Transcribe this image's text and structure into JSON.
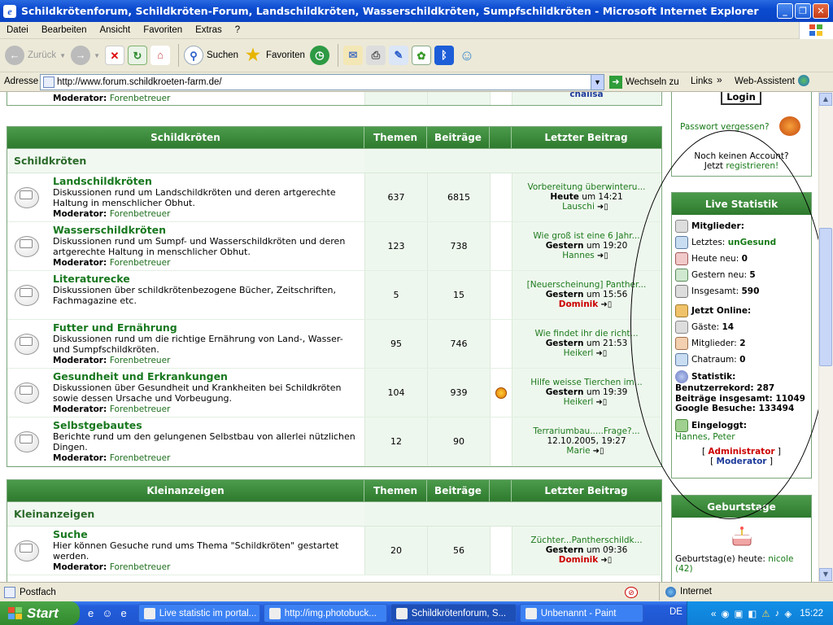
{
  "window": {
    "title": "Schildkrötenforum, Schildkröten-Forum, Landschildkröten, Wasserschildkröten, Sumpfschildkröten  - Microsoft Internet Explorer"
  },
  "menu": [
    "Datei",
    "Bearbeiten",
    "Ansicht",
    "Favoriten",
    "Extras",
    "?"
  ],
  "toolbar": {
    "back": "Zurück",
    "search": "Suchen",
    "favorites": "Favoriten"
  },
  "address": {
    "label": "Adresse",
    "url": "http://www.forum.schildkroeten-farm.de/",
    "go": "Wechseln zu",
    "links": "Links",
    "web_assistant": "Web-Assistent"
  },
  "top_row": {
    "moderator_label": "Moderator:",
    "moderator": "Forenbetreuer",
    "last_user": "chalisa"
  },
  "table1": {
    "headers": [
      "Schildkröten",
      "Themen",
      "Beiträge",
      "Letzter Beitrag"
    ],
    "category": "Schildkröten",
    "rows": [
      {
        "name": "Landschildkröten",
        "desc": "Diskussionen rund um Landschildkröten und deren artgerechte Haltung in menschlicher Obhut.",
        "mod_label": "Moderator:",
        "mod": "Forenbetreuer",
        "topics": "637",
        "posts": "6815",
        "last_title": "Vorbereitung überwinteru...",
        "last_day": "Heute",
        "last_time": "um 14:21",
        "last_user": "Lauschi"
      },
      {
        "name": "Wasserschildkröten",
        "desc": "Diskussionen rund um Sumpf- und Wasserschildkröten und deren artgerechte Haltung in menschlicher Obhut.",
        "mod_label": "Moderator:",
        "mod": "Forenbetreuer",
        "topics": "123",
        "posts": "738",
        "last_title": "Wie groß ist eine 6 Jahr...",
        "last_day": "Gestern",
        "last_time": "um 19:20",
        "last_user": "Hannes"
      },
      {
        "name": "Literaturecke",
        "desc": "Diskussionen über schildkrötenbezogene Bücher, Zeitschriften, Fachmagazine etc.",
        "mod_label": "",
        "mod": "",
        "topics": "5",
        "posts": "15",
        "last_title": "[Neuerscheinung] Panther...",
        "last_day": "Gestern",
        "last_time": "um 15:56",
        "last_user": "Dominik"
      },
      {
        "name": "Futter und Ernährung",
        "desc": "Diskussionen rund um die richtige Ernährung von Land-, Wasser- und Sumpfschildkröten.",
        "mod_label": "Moderator:",
        "mod": "Forenbetreuer",
        "topics": "95",
        "posts": "746",
        "last_title": "Wie findet ihr die richt...",
        "last_day": "Gestern",
        "last_time": "um 21:53",
        "last_user": "Heikerl"
      },
      {
        "name": "Gesundheit und Erkrankungen",
        "desc": "Diskussionen über Gesundheit und Krankheiten bei Schildkröten sowie dessen Ursache und Vorbeugung.",
        "mod_label": "Moderator:",
        "mod": "Forenbetreuer",
        "topics": "104",
        "posts": "939",
        "last_title": "Hilfe weisse Tierchen im...",
        "last_day": "Gestern",
        "last_time": "um 19:39",
        "last_user": "Heikerl"
      },
      {
        "name": "Selbstgebautes",
        "desc": "Berichte rund um den gelungenen Selbstbau von allerlei nützlichen Dingen.",
        "mod_label": "Moderator:",
        "mod": "Forenbetreuer",
        "topics": "12",
        "posts": "90",
        "last_title": "Terrariumbau.....Frage?...",
        "last_day": "",
        "last_time": "12.10.2005, 19:27",
        "last_user": "Marie"
      }
    ]
  },
  "table2": {
    "headers": [
      "Kleinanzeigen",
      "Themen",
      "Beiträge",
      "Letzter Beitrag"
    ],
    "category": "Kleinanzeigen",
    "rows": [
      {
        "name": "Suche",
        "desc": "Hier können Gesuche rund ums Thema \"Schildkröten\" gestartet werden.",
        "mod_label": "Moderator:",
        "mod": "Forenbetreuer",
        "topics": "20",
        "posts": "56",
        "last_title": "Züchter...Pantherschildk...",
        "last_day": "Gestern",
        "last_time": "um 09:36",
        "last_user": "Dominik"
      }
    ]
  },
  "login": {
    "button": "Login",
    "forgot": "Passwort vergessen?",
    "no_account": "Noch keinen Account?",
    "now": "Jetzt",
    "register": "registrieren!"
  },
  "stats": {
    "title": "Live Statistik",
    "members": "Mitglieder:",
    "latest_label": "Letztes:",
    "latest": "unGesund",
    "today_label": "Heute neu:",
    "today": "0",
    "yesterday_label": "Gestern neu:",
    "yesterday": "5",
    "total_label": "Insgesamt:",
    "total": "590",
    "online": "Jetzt Online:",
    "guests_label": "Gäste:",
    "guests": "14",
    "online_members_label": "Mitglieder:",
    "online_members": "2",
    "chat_label": "Chatraum:",
    "chat": "0",
    "statistik": "Statistik:",
    "record": "Benutzerrekord: 287",
    "posts_total": "Beiträge insgesamt: 11049",
    "google": "Google Besuche: 133494",
    "logged_in": "Eingeloggt:",
    "logged_users": "Hannes, Peter",
    "admin": "Administrator",
    "moderator": "Moderator"
  },
  "birthdays": {
    "title": "Geburtstage",
    "text": "Geburtstag(e) heute:",
    "name": "nicole",
    "age": "(42)"
  },
  "status": {
    "left": "Postfach",
    "zone": "Internet"
  },
  "taskbar": {
    "start": "Start",
    "tasks": [
      "Live statistic im portal...",
      "http://img.photobuck...",
      "Schildkrötenforum, S...",
      "Unbenannt - Paint"
    ],
    "lang": "DE",
    "clock": "15:22"
  },
  "colors": {
    "forum_green": "#2e7a2e",
    "link_green": "#17781e",
    "xp_blue": "#245edb"
  }
}
